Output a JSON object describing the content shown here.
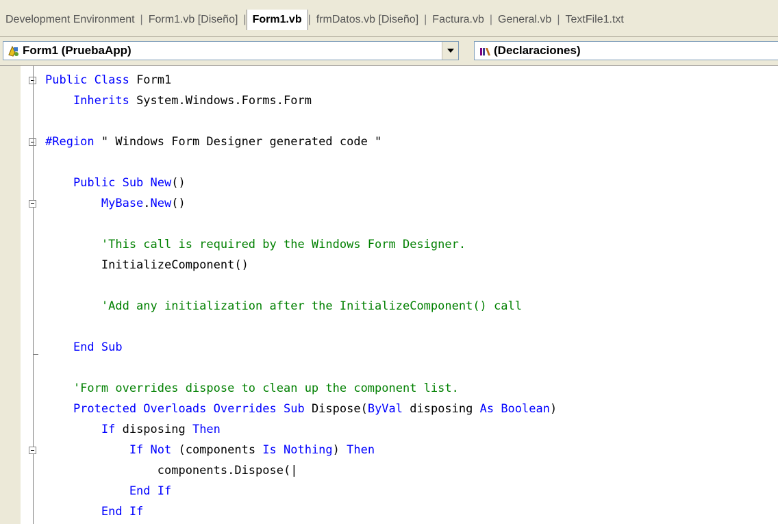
{
  "tabs": [
    {
      "label": "Development Environment",
      "active": false
    },
    {
      "label": "Form1.vb [Diseño]",
      "active": false
    },
    {
      "label": "Form1.vb",
      "active": true
    },
    {
      "label": "frmDatos.vb [Diseño]",
      "active": false
    },
    {
      "label": "Factura.vb",
      "active": false
    },
    {
      "label": "General.vb",
      "active": false
    },
    {
      "label": "TextFile1.txt",
      "active": false
    }
  ],
  "navbar": {
    "class_combo": "Form1 (PruebaApp)",
    "member_combo": "(Declaraciones)"
  },
  "code": {
    "lines": [
      [
        {
          "t": "Public Class",
          "c": "kw"
        },
        {
          "t": " Form1",
          "c": ""
        }
      ],
      [
        {
          "t": "    Inherits",
          "c": "kw"
        },
        {
          "t": " System.Windows.Forms.Form",
          "c": ""
        }
      ],
      [],
      [
        {
          "t": "#Region",
          "c": "kw"
        },
        {
          "t": " \" Windows Form Designer generated code \"",
          "c": ""
        }
      ],
      [],
      [
        {
          "t": "    Public Sub New",
          "c": "kw"
        },
        {
          "t": "()",
          "c": ""
        }
      ],
      [
        {
          "t": "        MyBase",
          "c": "kw"
        },
        {
          "t": ".",
          "c": ""
        },
        {
          "t": "New",
          "c": "kw"
        },
        {
          "t": "()",
          "c": ""
        }
      ],
      [],
      [
        {
          "t": "        'This call is required by the Windows Form Designer.",
          "c": "cm"
        }
      ],
      [
        {
          "t": "        InitializeComponent()",
          "c": ""
        }
      ],
      [],
      [
        {
          "t": "        'Add any initialization after the InitializeComponent() call",
          "c": "cm"
        }
      ],
      [],
      [
        {
          "t": "    End Sub",
          "c": "kw"
        }
      ],
      [],
      [
        {
          "t": "    'Form overrides dispose to clean up the component list.",
          "c": "cm"
        }
      ],
      [
        {
          "t": "    Protected Overloads Overrides Sub",
          "c": "kw"
        },
        {
          "t": " Dispose(",
          "c": ""
        },
        {
          "t": "ByVal",
          "c": "kw"
        },
        {
          "t": " disposing ",
          "c": ""
        },
        {
          "t": "As Boolean",
          "c": "kw"
        },
        {
          "t": ")",
          "c": ""
        }
      ],
      [
        {
          "t": "        If",
          "c": "kw"
        },
        {
          "t": " disposing ",
          "c": ""
        },
        {
          "t": "Then",
          "c": "kw"
        }
      ],
      [
        {
          "t": "            If Not",
          "c": "kw"
        },
        {
          "t": " (components ",
          "c": ""
        },
        {
          "t": "Is Nothing",
          "c": "kw"
        },
        {
          "t": ") ",
          "c": ""
        },
        {
          "t": "Then",
          "c": "kw"
        }
      ],
      [
        {
          "t": "                components.Dispose(|",
          "c": ""
        }
      ],
      [
        {
          "t": "            End If",
          "c": "kw"
        }
      ],
      [
        {
          "t": "        End If",
          "c": "kw"
        }
      ]
    ]
  },
  "icons": {
    "class_combo_icon": "class-icon",
    "member_combo_icon": "members-icon",
    "dropdown": "chevron-down-icon"
  },
  "colors": {
    "keyword": "#0000ff",
    "comment": "#008000",
    "text": "#000000"
  }
}
